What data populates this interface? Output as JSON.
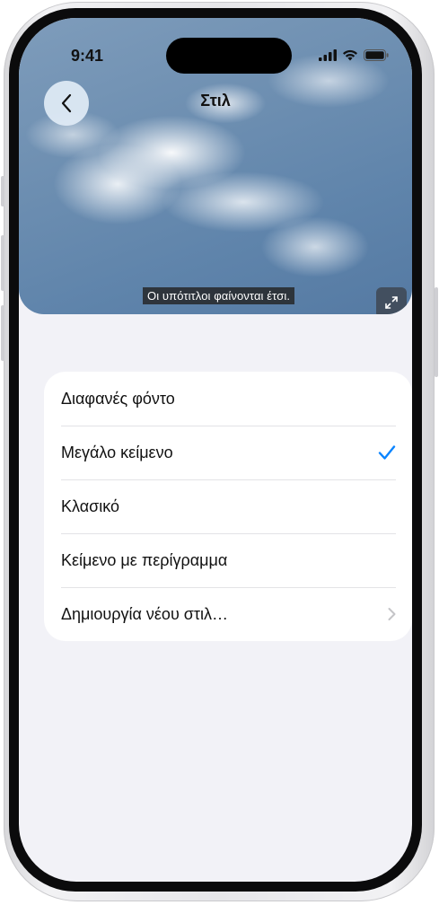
{
  "status_bar": {
    "time": "9:41",
    "icons": [
      "cellular-signal-icon",
      "wifi-icon",
      "battery-icon"
    ]
  },
  "navigation": {
    "title": "Στιλ",
    "back_icon": "chevron-left-icon"
  },
  "preview": {
    "caption_sample": "Οι υπότιτλοι φαίνονται έτσι.",
    "expand_icon": "expand-arrows-icon"
  },
  "styles_list": {
    "items": [
      {
        "label": "Διαφανές φόντο",
        "selected": false,
        "accessory": "none"
      },
      {
        "label": "Μεγάλο κείμενο",
        "selected": true,
        "accessory": "checkmark-icon"
      },
      {
        "label": "Κλασικό",
        "selected": false,
        "accessory": "none"
      },
      {
        "label": "Κείμενο με περίγραμμα",
        "selected": false,
        "accessory": "none"
      },
      {
        "label": "Δημιουργία νέου στιλ…",
        "selected": false,
        "accessory": "chevron-right-icon"
      }
    ]
  },
  "colors": {
    "accent": "#0a84ff",
    "background": "#f2f2f7",
    "card": "#ffffff",
    "separator": "#e3e3e6",
    "chevron": "#c4c4c7"
  }
}
